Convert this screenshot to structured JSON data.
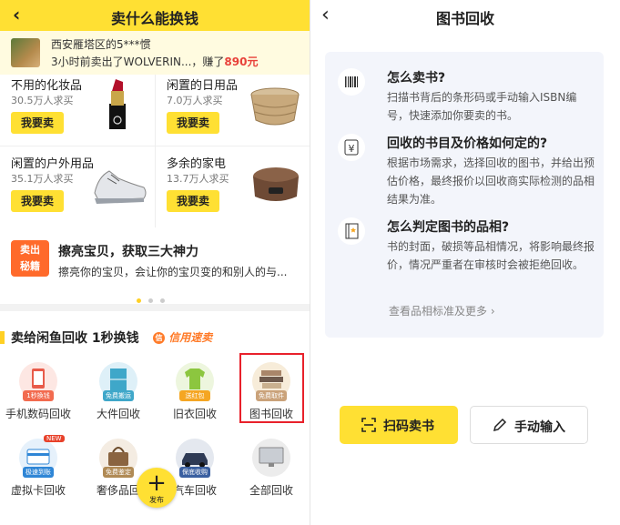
{
  "left": {
    "header": {
      "title": "卖什么能换钱"
    },
    "ticker": {
      "line1": "西安雁塔区的5***惯",
      "line2_prefix": "3小时前卖出了WOLVERIN...，赚了",
      "amount": "890元"
    },
    "categories": [
      {
        "name": "不用的化妆品",
        "count": "30.5万人求买",
        "button": "我要卖"
      },
      {
        "name": "闲置的日用品",
        "count": "7.0万人求买",
        "button": "我要卖"
      },
      {
        "name": "闲置的户外用品",
        "count": "35.1万人求买",
        "button": "我要卖"
      },
      {
        "name": "多余的家电",
        "count": "13.7万人求买",
        "button": "我要卖"
      }
    ],
    "promo": {
      "badge_line1": "卖出",
      "badge_line2": "秘籍",
      "title": "擦亮宝贝，获取三大神力",
      "subtitle": "擦亮你的宝贝，会让你的宝贝变的和别人的与..."
    },
    "recycle": {
      "title": "卖给闲鱼回收 1秒换钱",
      "credit": "信用速卖",
      "items": [
        {
          "label": "手机数码回收",
          "tag": "1秒換钱"
        },
        {
          "label": "大件回收",
          "tag": "免费搬运"
        },
        {
          "label": "旧衣回收",
          "tag": "送红包"
        },
        {
          "label": "图书回收",
          "tag": "免费取件"
        },
        {
          "label": "虚拟卡回收",
          "tag": "极速到账",
          "corner": "NEW"
        },
        {
          "label": "奢侈品回",
          "tag": "免费鉴定"
        },
        {
          "label": "汽车回收",
          "tag": "保底收购"
        },
        {
          "label": "全部回收",
          "tag": ""
        }
      ],
      "fab": "发布"
    }
  },
  "right": {
    "header": {
      "title": "图书回收"
    },
    "faqs": [
      {
        "icon": "barcode-icon",
        "title": "怎么卖书?",
        "body": "扫描书背后的条形码或手动输入ISBN编号，快速添加你要卖的书。"
      },
      {
        "icon": "yen-icon",
        "title": "回收的书目及价格如何定的?",
        "body": "根据市场需求，选择回收的图书，并给出预估价格，最终报价以回收商实际检测的品相结果为准。"
      },
      {
        "icon": "book-quality-icon",
        "title": "怎么判定图书的品相?",
        "body": "书的封面，破损等品相情况，将影响最终报价，情况严重者在审核时会被拒绝回收。"
      }
    ],
    "more_link": "查看品相标准及更多",
    "scan_button": "扫码卖书",
    "manual_button": "手动输入"
  },
  "colors": {
    "brand_yellow": "#ffe033",
    "accent_orange": "#ff7b29",
    "price_red": "#e8413a",
    "highlight_red": "#e8212b"
  }
}
